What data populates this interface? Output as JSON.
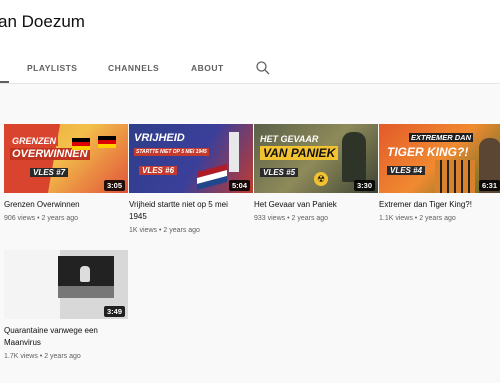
{
  "channel": {
    "name": "an Doezum"
  },
  "tabs": [
    {
      "label": "PLAYLISTS"
    },
    {
      "label": "CHANNELS"
    },
    {
      "label": "ABOUT"
    }
  ],
  "videos": [
    {
      "title": "Grenzen Overwinnen",
      "title2": "",
      "views": "906 views",
      "age": "2 years ago",
      "duration": "3:05",
      "thumb": {
        "line1": "GRENZEN",
        "line2": "OVERWINNEN",
        "tag": "VLES #7"
      }
    },
    {
      "title": "Vrijheid startte niet op 5 mei",
      "title2": "1945",
      "views": "1K views",
      "age": "2 years ago",
      "duration": "5:04",
      "thumb": {
        "line1": "VRIJHEID",
        "line2": "STARTTE NIET OP 5 MEI 1945",
        "tag": "VLES #6"
      }
    },
    {
      "title": "Het Gevaar van Paniek",
      "title2": "",
      "views": "933 views",
      "age": "2 years ago",
      "duration": "3:30",
      "thumb": {
        "line1": "HET GEVAAR",
        "line2": "VAN PANIEK",
        "tag": "VLES #5"
      }
    },
    {
      "title": "Extremer dan Tiger King?!",
      "title2": "",
      "views": "1.1K views",
      "age": "2 years ago",
      "duration": "6:31",
      "thumb": {
        "line1": "EXTREMER DAN",
        "line2": "TIGER KING?!",
        "tag": "VLES #4"
      }
    },
    {
      "title": "Quarantaine vanwege een",
      "title2": "Maanvirus",
      "views": "1.7K views",
      "age": "2 years ago",
      "duration": "3:49",
      "thumb": {
        "line1": "",
        "line2": "",
        "tag": ""
      }
    }
  ]
}
